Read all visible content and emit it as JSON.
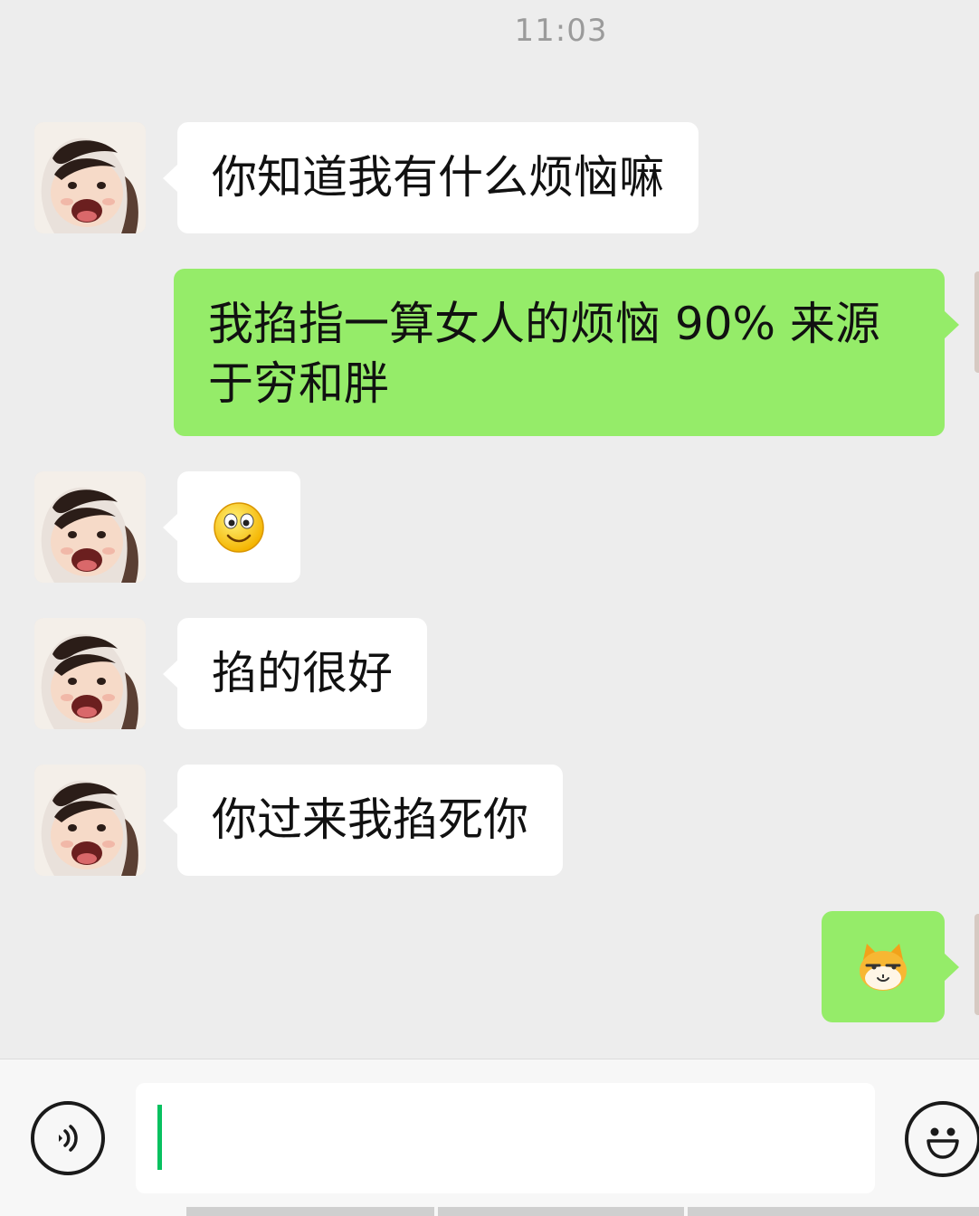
{
  "status": {
    "time": "11:03"
  },
  "messages": [
    {
      "side": "left",
      "type": "text",
      "text": "你知道我有什么烦恼嘛"
    },
    {
      "side": "right",
      "type": "text",
      "line1": "我掐指一算女人的烦恼 90% 来源",
      "line2": "于穷和胖"
    },
    {
      "side": "left",
      "type": "emoji",
      "emoji": "smile-emoji"
    },
    {
      "side": "left",
      "type": "text",
      "text": "掐的很好"
    },
    {
      "side": "left",
      "type": "text",
      "text": "你过来我掐死你"
    },
    {
      "side": "right",
      "type": "emoji",
      "emoji": "smirking-cat-emoji"
    }
  ],
  "input": {
    "value": ""
  },
  "colors": {
    "background": "#ededed",
    "own_bubble": "#95ec69",
    "other_bubble": "#ffffff",
    "cursor": "#07c160"
  },
  "icons": {
    "voice": "voice-icon",
    "emoji": "emoji-icon",
    "avatar": "avatar-child-image"
  }
}
